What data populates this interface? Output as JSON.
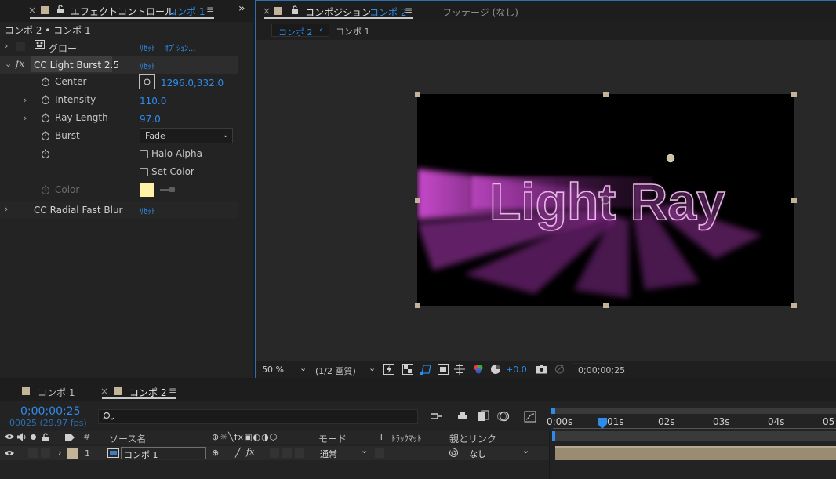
{
  "effect_panel": {
    "close": "×",
    "tab_title": "エフェクトコントロール",
    "tab_comp": "コンポ 1",
    "menu": "≡",
    "expand": "»",
    "breadcrumb": "コンポ 2 • コンポ 1",
    "reset": "ﾘｾｯﾄ",
    "options": "ｵﾌﾟｼｮﾝ...",
    "glow_label": "グロー",
    "fx": "fx",
    "effect1_name": "CC Light Burst 2.5",
    "params": {
      "center_label": "Center",
      "center_value": "1296.0,332.0",
      "intensity_label": "Intensity",
      "intensity_value": "110.0",
      "ray_length_label": "Ray Length",
      "ray_length_value": "97.0",
      "burst_label": "Burst",
      "burst_value": "Fade",
      "halo_alpha_label": "Halo Alpha",
      "set_color_label": "Set Color",
      "color_label": "Color",
      "color_value": "#fff2a6"
    },
    "effect2_name": "CC Radial Fast Blur"
  },
  "comp_panel": {
    "close": "×",
    "tab_title": "コンポジション",
    "tab_comp": "コンポ 2",
    "menu": "≡",
    "footage_tab": "フッテージ (なし)",
    "sub_tab_active": "コンポ 2",
    "sub_tab_arrow": "‹",
    "sub_tab_other": "コンポ 1",
    "canvas_text": "Light Ray",
    "zoom": "50 %",
    "quality": "(1/2 画質)",
    "exposure": "+0.0",
    "timecode": "0;00;00;25"
  },
  "timeline": {
    "tab1": "コンポ 1",
    "tab2_close": "×",
    "tab2": "コンポ 2",
    "menu": "≡",
    "timecode": "0;00;00;25",
    "frames": "00025 (29.97 fps)",
    "search_placeholder": "",
    "col_hash": "#",
    "col_source": "ソース名",
    "col_mode": "モード",
    "col_t": "T",
    "col_trackmatte": "ﾄﾗｯｸﾏｯﾄ",
    "col_parent": "親とリンク",
    "layer_num": "1",
    "layer_name": "コンポ 1",
    "layer_mode": "通常",
    "layer_parent": "なし",
    "ruler": [
      "0:00s",
      "01s",
      "02s",
      "03s",
      "04s",
      "05"
    ]
  },
  "colors": {
    "accent": "#2d8ceb",
    "layer_label": "#c2b399",
    "ray_magenta": "#d24ed6"
  }
}
